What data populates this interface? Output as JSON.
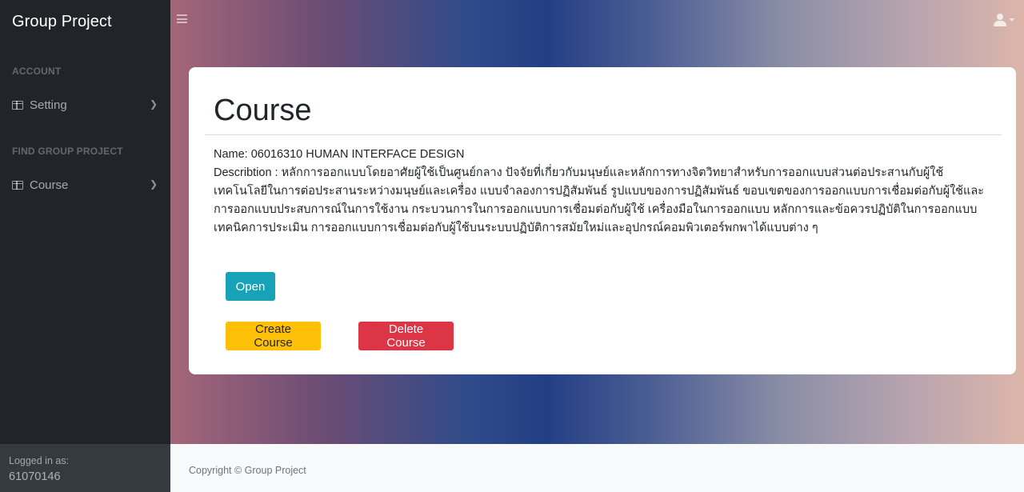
{
  "sidebar": {
    "brand": "Group Project",
    "section_account": "ACCOUNT",
    "item_setting": "Setting",
    "section_find": "FIND GROUP PROJECT",
    "item_course": "Course",
    "footer_label": "Logged in as:",
    "footer_user": "61070146"
  },
  "card": {
    "title": "Course",
    "name_line": "Name: 06016310 HUMAN INTERFACE DESIGN",
    "description": "Describtion : หลักการออกแบบโดยอาศัยผู้ใช้เป็นศูนย์กลาง ปัจจัยที่เกี่ยวกับมนุษย์และหลักการทางจิตวิทยาสำหรับการออกแบบส่วนต่อประสานกับผู้ใช้ เทคโนโลยีในการต่อประสานระหว่างมนุษย์และเครื่อง แบบจำลองการปฏิสัมพันธ์ รูปแบบของการปฏิสัมพันธ์ ขอบเขตของการออกแบบการเชื่อมต่อกับผู้ใช้และการออกแบบประสบการณ์ในการใช้งาน กระบวนการในการออกแบบการเชื่อมต่อกับผู้ใช้ เครื่องมือในการออกแบบ หลักการและข้อควรปฏิบัติในการออกแบบ เทคนิคการประเมิน การออกแบบการเชื่อมต่อกับผู้ใช้บนระบบปฏิบัติการสมัยใหม่และอุปกรณ์คอมพิวเตอร์พกพาได้แบบต่าง ๆ",
    "btn_open": "Open",
    "btn_create": "Create Course",
    "btn_delete": "Delete Course"
  },
  "footer": {
    "copyright": "Copyright © Group Project"
  },
  "icons": {
    "menu": "hamburger-icon",
    "user": "user-icon",
    "sidebar_item": "table-icon",
    "chevron": "chevron-right-icon"
  },
  "colors": {
    "sidebar_bg": "#212529",
    "open_btn": "#17a2b8",
    "create_btn": "#ffc107",
    "delete_btn": "#dc3545"
  }
}
